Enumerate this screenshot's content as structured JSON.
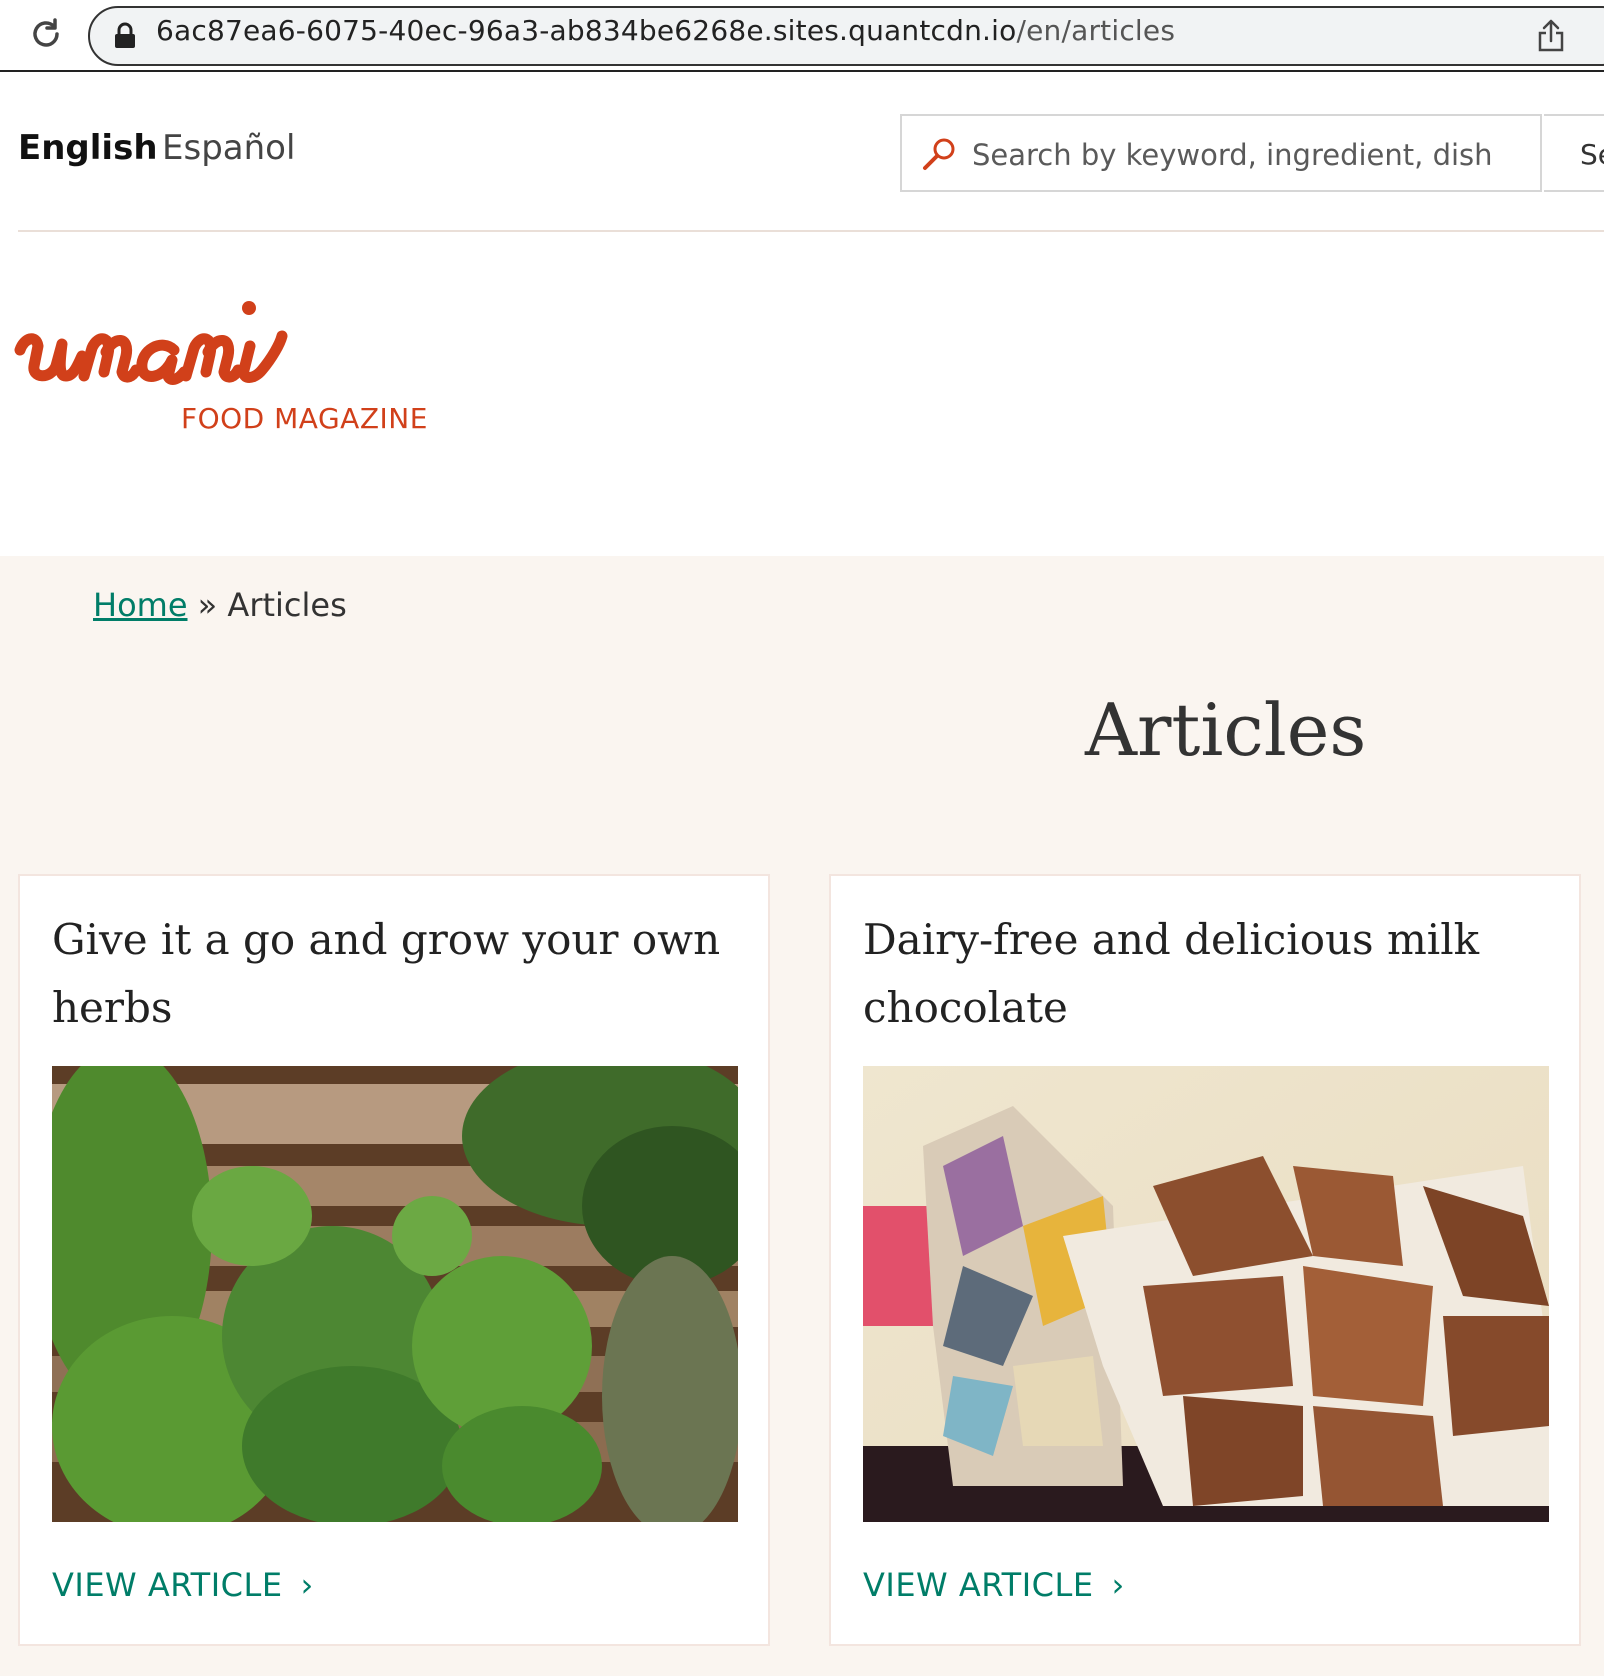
{
  "browser": {
    "url_host": "6ac87ea6-6075-40ec-96a3-ab834be6268e.sites.quantcdn.io",
    "url_path": "/en/articles"
  },
  "header": {
    "languages": [
      "English",
      "Español"
    ],
    "search_placeholder": "Search by keyword, ingredient, dish",
    "search_button_label": "Search"
  },
  "logo": {
    "wordmark": "umami",
    "subtitle": "FOOD MAGAZINE"
  },
  "breadcrumb": {
    "home": "Home",
    "separator": "»",
    "current": "Articles"
  },
  "page": {
    "title": "Articles"
  },
  "articles": [
    {
      "title": "Give it a go and grow your own herbs",
      "link_label": "VIEW ARTICLE",
      "image": "herbs-photo"
    },
    {
      "title": "Dairy-free and delicious milk chocolate",
      "link_label": "VIEW ARTICLE",
      "image": "chocolate-photo"
    }
  ],
  "colors": {
    "brand": "#d1401a",
    "link": "#007d68",
    "main_bg": "#faf5f0"
  }
}
